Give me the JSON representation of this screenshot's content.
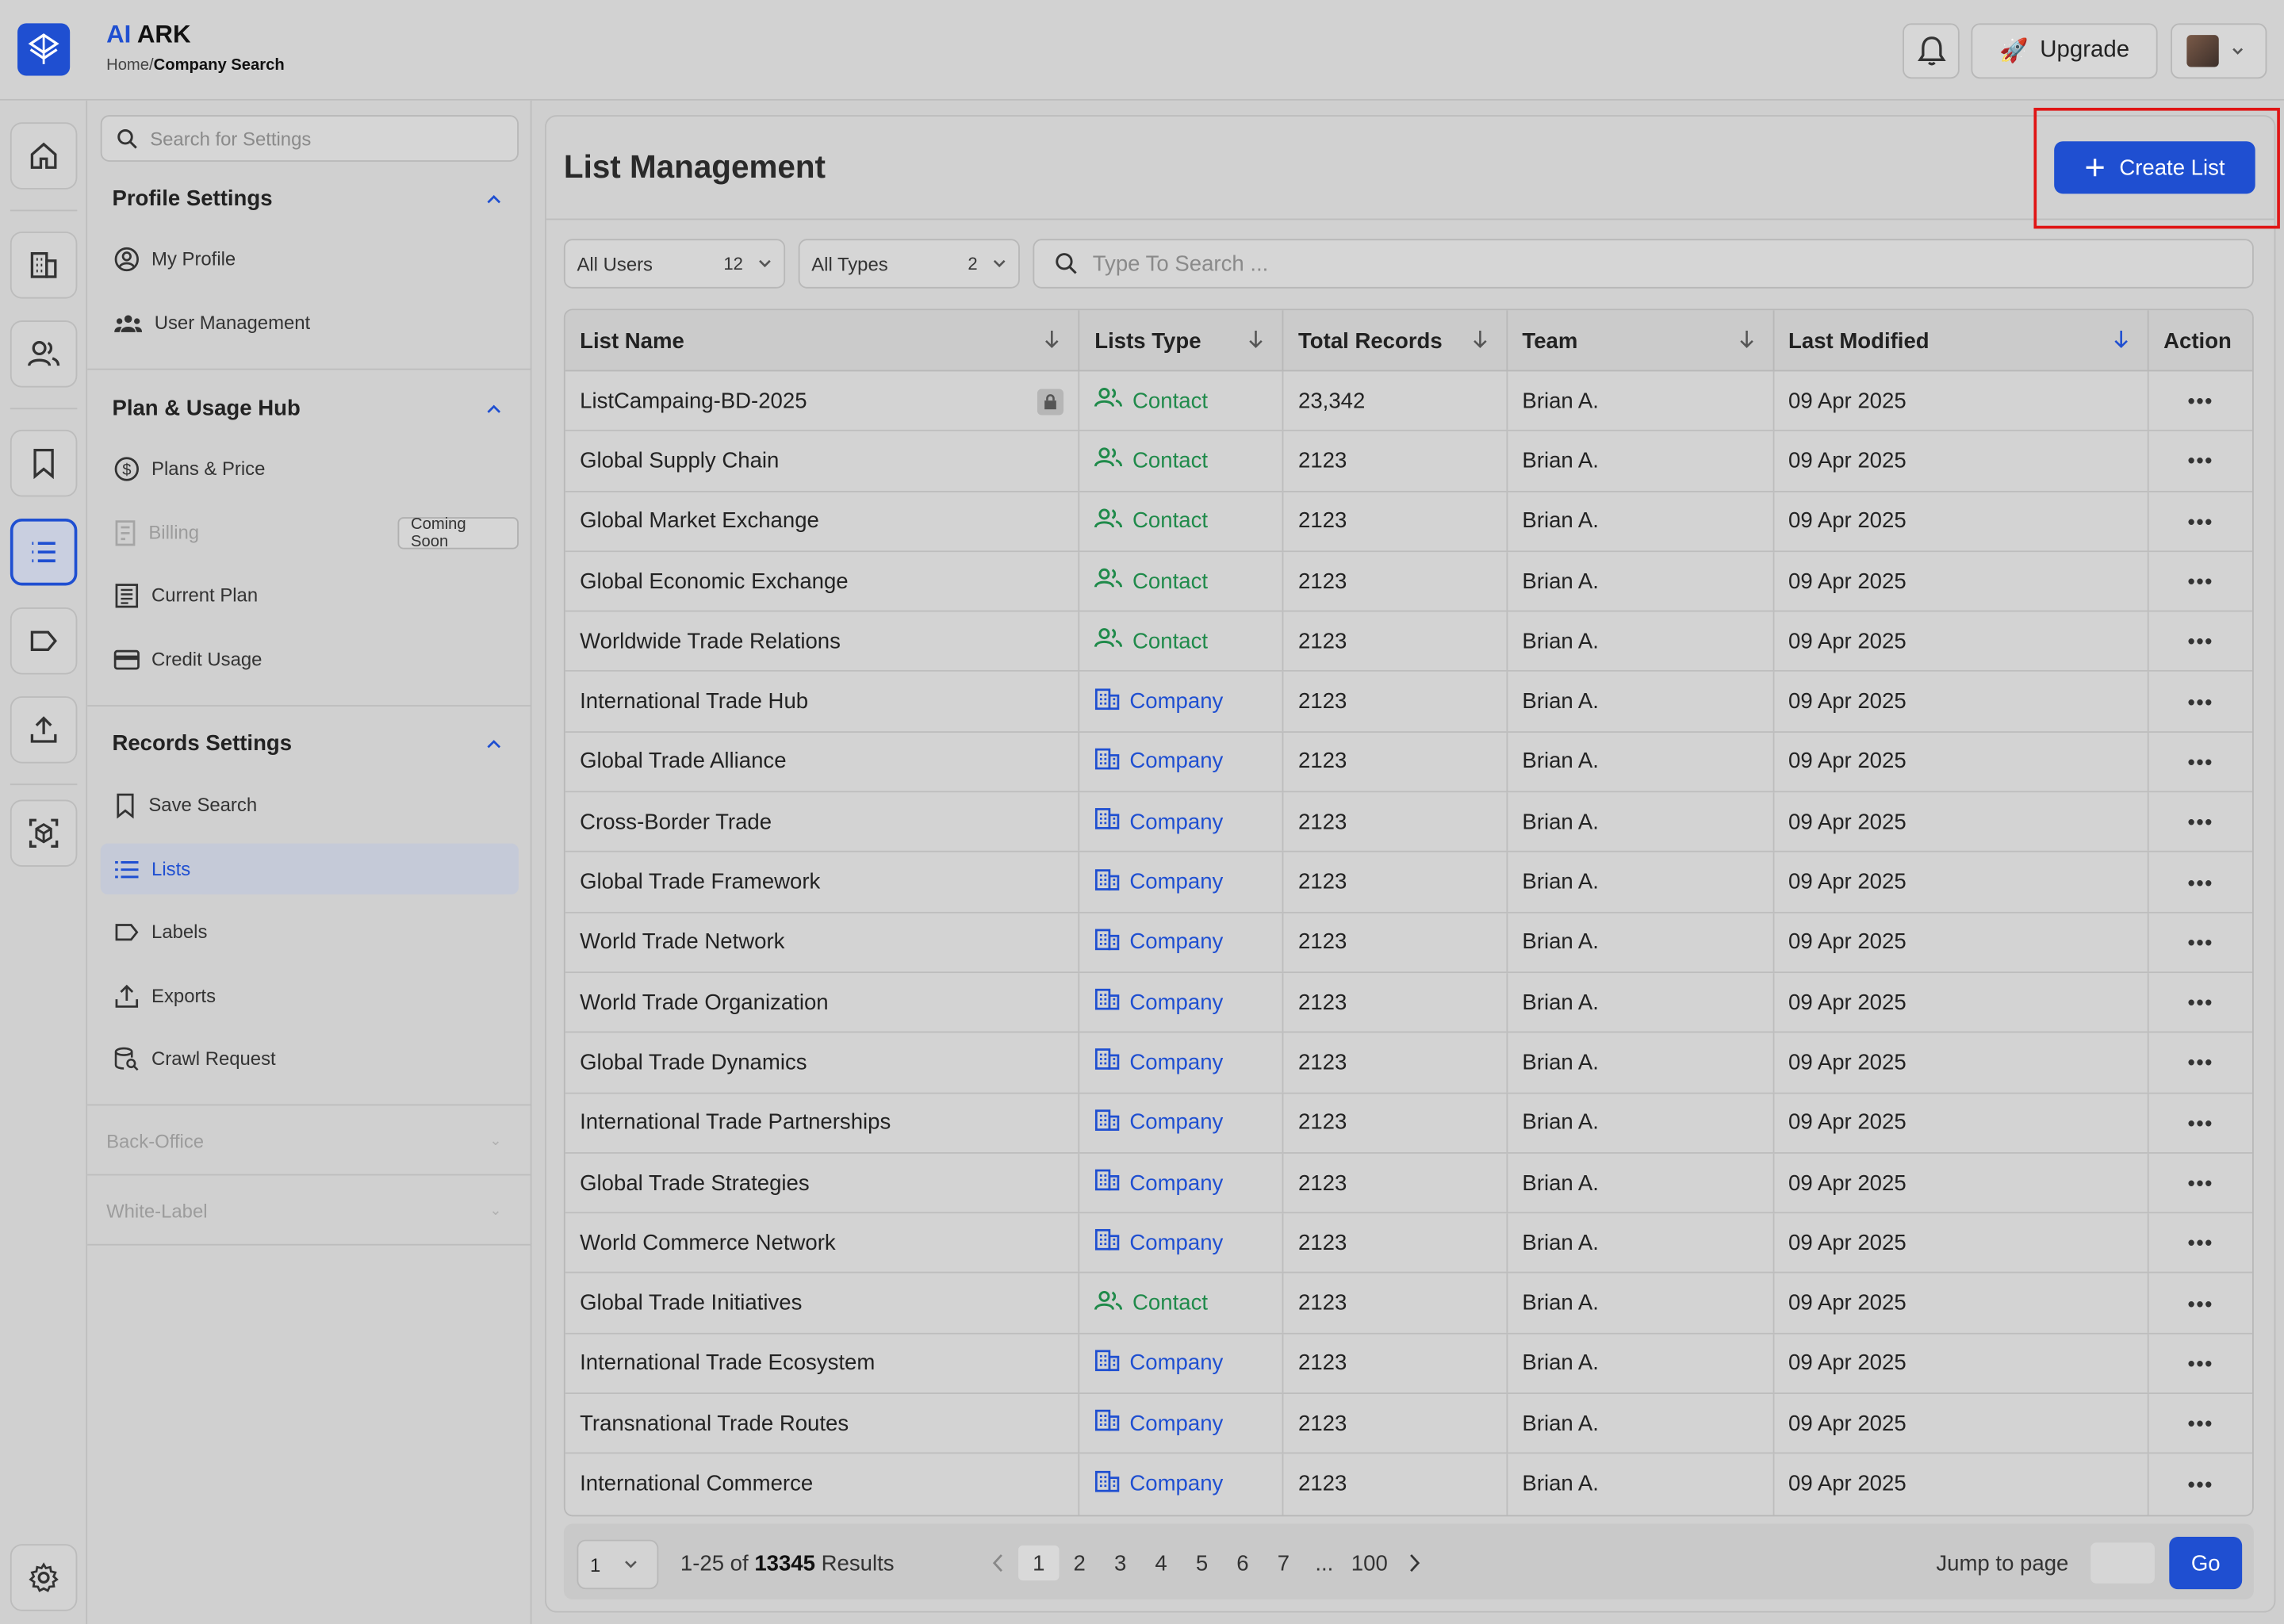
{
  "header": {
    "brand_ai": "AI",
    "brand_name": " ARK",
    "crumb_home": "Home/",
    "crumb_current": "Company Search",
    "upgrade_label": "Upgrade",
    "upgrade_emoji": "🚀"
  },
  "sidebar": {
    "search_placeholder": "Search for Settings",
    "profile_title": "Profile Settings",
    "profile_items": [
      "My Profile",
      "User Management"
    ],
    "plan_title": "Plan & Usage Hub",
    "plan_items": [
      "Plans & Price",
      "Billing",
      "Current Plan",
      "Credit Usage"
    ],
    "coming_soon": "Coming Soon",
    "records_title": "Records Settings",
    "records_items": [
      "Save Search",
      "Lists",
      "Labels",
      "Exports",
      "Crawl Request"
    ],
    "back_office": "Back-Office",
    "white_label": "White-Label"
  },
  "main": {
    "title": "List Management",
    "create_label": "Create List",
    "filter_users": "All Users",
    "filter_users_count": "12",
    "filter_types": "All Types",
    "filter_types_count": "2",
    "search_placeholder": "Type To Search ..."
  },
  "table": {
    "columns": [
      "List Name",
      "Lists Type",
      "Total Records",
      "Team",
      "Last Modified",
      "Action"
    ],
    "rows": [
      {
        "name": "ListCampaing-BD-2025",
        "type": "Contact",
        "records": "23,342",
        "team": "Brian A.",
        "modified": "09 Apr 2025",
        "locked": true
      },
      {
        "name": "Global Supply Chain",
        "type": "Contact",
        "records": "2123",
        "team": "Brian A.",
        "modified": "09 Apr 2025"
      },
      {
        "name": "Global Market Exchange",
        "type": "Contact",
        "records": "2123",
        "team": "Brian A.",
        "modified": "09 Apr 2025"
      },
      {
        "name": "Global Economic Exchange",
        "type": "Contact",
        "records": "2123",
        "team": "Brian A.",
        "modified": "09 Apr 2025"
      },
      {
        "name": "Worldwide Trade Relations",
        "type": "Contact",
        "records": "2123",
        "team": "Brian A.",
        "modified": "09 Apr 2025"
      },
      {
        "name": "International Trade Hub",
        "type": "Company",
        "records": "2123",
        "team": "Brian A.",
        "modified": "09 Apr 2025"
      },
      {
        "name": "Global Trade Alliance",
        "type": "Company",
        "records": "2123",
        "team": "Brian A.",
        "modified": "09 Apr 2025"
      },
      {
        "name": "Cross-Border Trade",
        "type": "Company",
        "records": "2123",
        "team": "Brian A.",
        "modified": "09 Apr 2025"
      },
      {
        "name": "Global Trade Framework",
        "type": "Company",
        "records": "2123",
        "team": "Brian A.",
        "modified": "09 Apr 2025"
      },
      {
        "name": "World Trade Network",
        "type": "Company",
        "records": "2123",
        "team": "Brian A.",
        "modified": "09 Apr 2025"
      },
      {
        "name": "World Trade Organization",
        "type": "Company",
        "records": "2123",
        "team": "Brian A.",
        "modified": "09 Apr 2025"
      },
      {
        "name": "Global Trade Dynamics",
        "type": "Company",
        "records": "2123",
        "team": "Brian A.",
        "modified": "09 Apr 2025"
      },
      {
        "name": "International Trade Partnerships",
        "type": "Company",
        "records": "2123",
        "team": "Brian A.",
        "modified": "09 Apr 2025"
      },
      {
        "name": "Global Trade Strategies",
        "type": "Company",
        "records": "2123",
        "team": "Brian A.",
        "modified": "09 Apr 2025"
      },
      {
        "name": "World Commerce Network",
        "type": "Company",
        "records": "2123",
        "team": "Brian A.",
        "modified": "09 Apr 2025"
      },
      {
        "name": "Global Trade Initiatives",
        "type": "Contact",
        "records": "2123",
        "team": "Brian A.",
        "modified": "09 Apr 2025"
      },
      {
        "name": "International Trade Ecosystem",
        "type": "Company",
        "records": "2123",
        "team": "Brian A.",
        "modified": "09 Apr 2025"
      },
      {
        "name": "Transnational Trade Routes",
        "type": "Company",
        "records": "2123",
        "team": "Brian A.",
        "modified": "09 Apr 2025"
      },
      {
        "name": "International Commerce",
        "type": "Company",
        "records": "2123",
        "team": "Brian A.",
        "modified": "09 Apr 2025"
      }
    ],
    "action_glyph": "•••"
  },
  "pagination": {
    "per_page": "1",
    "range": "1-25 of ",
    "total": "13345",
    "results_word": " Results",
    "pages": [
      "1",
      "2",
      "3",
      "4",
      "5",
      "6",
      "7",
      "...",
      "100"
    ],
    "current_page": "1",
    "jump_label": "Jump to page",
    "go_label": "Go"
  },
  "colors": {
    "accent": "#1f4fd1",
    "contact": "#1f8a4a",
    "highlight": "#e01515"
  }
}
